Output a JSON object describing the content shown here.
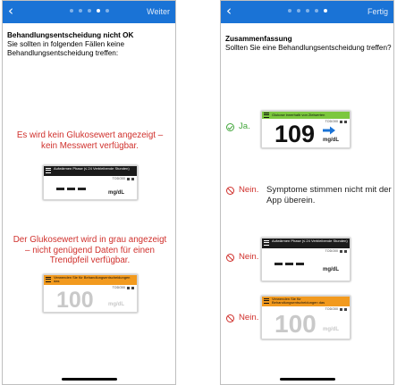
{
  "left": {
    "header": {
      "back": "‹",
      "action": "Weiter",
      "dots": 5,
      "active_dot": 3
    },
    "title": "Behandlungsentscheidung nicht OK",
    "subtitle": "Sie sollten in folgenden Fällen keine Behandlungsentscheidung treffen:",
    "case1_text": "Es wird kein Glukosewert angezeigt – kein Messwert verfügbar.",
    "case1_card": {
      "bar_text": "Aufwärmen Phase (≤ 24 Verbleibende Stunden)",
      "status_time": "TODO00",
      "unit": "mg/dL"
    },
    "case2_text": "Der Glukosewert wird in grau angezeigt – nicht genügend Daten für einen Trendpfeil verfügbar.",
    "case2_card": {
      "bar_text": "Verwenden Sie für Behandlungsentscheidungen das",
      "status_time": "TODO00",
      "value": "100",
      "unit": "mg/dL"
    }
  },
  "right": {
    "header": {
      "back": "‹",
      "action": "Fertig",
      "dots": 5,
      "active_dot": 4
    },
    "title": "Zusammenfassung",
    "subtitle": "Sollten Sie eine Behandlungsentscheidung treffen?",
    "row1": {
      "label": "Ja.",
      "card": {
        "bar_text": "Glukose innerhalb von Zielwerten",
        "status_time": "TODO00",
        "value": "109",
        "unit": "mg/dL"
      }
    },
    "row2": {
      "label": "Nein.",
      "text": "Symptome stimmen nicht mit der App überein."
    },
    "row3": {
      "label": "Nein.",
      "card": {
        "bar_text": "Aufwärmen Phase (≤ 24 Verbleibende Stunden)",
        "status_time": "TODO00",
        "unit": "mg/dL"
      }
    },
    "row4": {
      "label": "Nein.",
      "card": {
        "bar_text": "Verwenden Sie für Behandlungsentscheidungen das",
        "status_time": "TODO00",
        "value": "100",
        "unit": "mg/dL"
      }
    }
  },
  "colors": {
    "header_blue": "#1a73d6",
    "alert_red": "#d0312d",
    "ok_green": "#41a53a",
    "orange_bar": "#f29a1e",
    "green_bar": "#7cc73e",
    "trend_arrow": "#1a73d6"
  }
}
